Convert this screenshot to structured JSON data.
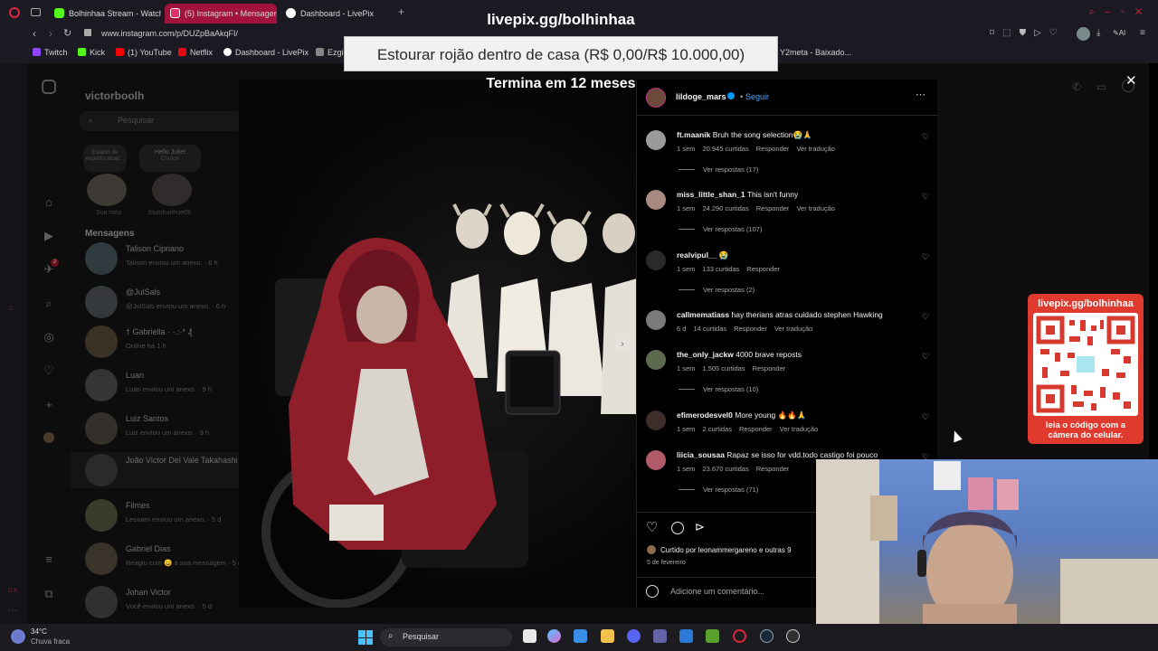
{
  "browser": {
    "tabs": [
      {
        "label": "Bolhinhaa Stream - Watch",
        "color": "#53fc18"
      },
      {
        "label": "(5) Instagram • Mensagen",
        "color": "#e1306c"
      },
      {
        "label": "Dashboard - LivePix",
        "color": "#ffffff"
      }
    ],
    "new_tab": "+",
    "url": "www.instagram.com/p/DUZpBaAkqFI/",
    "bookmarks": [
      {
        "label": "Twitch",
        "color": "#9146ff"
      },
      {
        "label": "Kick",
        "color": "#53fc18"
      },
      {
        "label": "(1) YouTube",
        "color": "#ff0000"
      },
      {
        "label": "Netflix",
        "color": "#e50914"
      },
      {
        "label": "Dashboard - LivePix",
        "color": "#ffffff"
      },
      {
        "label": "Ezgi",
        "color": "#888888"
      },
      {
        "label": "Y2meta - Baixado...",
        "color": "#888888"
      }
    ]
  },
  "overlay": {
    "top_url": "livepix.gg/bolhinhaa",
    "donation_goal": "Estourar rojão dentro de casa (R$ 0,00/R$ 10.000,00)",
    "ends_in": "Termina em 12 meses",
    "qr_title": "livepix.gg/bolhinhaa",
    "qr_caption": "leia o código com a câmera do celular."
  },
  "instagram": {
    "account": "victorboolh",
    "search_placeholder": "Pesquisar",
    "notes": [
      {
        "label": "Estado de espírito atual...",
        "sub": "Sua nota"
      },
      {
        "label": "Hello Juliet",
        "sub": "Clarion",
        "sub2": "thurshuehue69"
      }
    ],
    "messages_header": "Mensagens",
    "dms": [
      {
        "name": "Talison Cipriano",
        "sub": "Talison enviou um anexo. · 6 h"
      },
      {
        "name": "@JulSals",
        "sub": "@JulSals enviou um anexo. · 6 h"
      },
      {
        "name": "† Gabriella · ·.:·* ₰",
        "sub": "Online há 1 h"
      },
      {
        "name": "Luan",
        "sub": "Luan enviou um anexo. · 9 h"
      },
      {
        "name": "Luiz Santos",
        "sub": "Luiz enviou um anexo. · 9 h"
      },
      {
        "name": "João Victor Del Vale Takahashi",
        "sub": ""
      },
      {
        "name": "Filmes",
        "sub": "Leonam enviou um anexo. · 5 d"
      },
      {
        "name": "Gabriel Dias",
        "sub": "Reagiu com 😄 à sua mensagem · 5 d"
      },
      {
        "name": "Johan Victor",
        "sub": "Você enviou um anexo. · 5 d"
      }
    ],
    "notification_badge": "2",
    "post": {
      "author": "lildoge_mars",
      "follow": "Seguir",
      "comments": [
        {
          "user": "ft.maanik",
          "text": "Bruh the song selection😭🙏",
          "time": "1 sem",
          "likes": "20.945 curtidas",
          "reply": "Responder",
          "translate": "Ver tradução",
          "replies": "Ver respostas (17)"
        },
        {
          "user": "miss_little_shan_1",
          "text": "This isn't funny",
          "time": "1 sem",
          "likes": "24.290 curtidas",
          "reply": "Responder",
          "translate": "Ver tradução",
          "replies": "Ver respostas (107)"
        },
        {
          "user": "realvipul__",
          "text": "😭",
          "time": "1 sem",
          "likes": "133 curtidas",
          "reply": "Responder",
          "translate": "",
          "replies": "Ver respostas (2)"
        },
        {
          "user": "callmematiass",
          "text": "hay therians atras cuidado stephen Hawking",
          "time": "6 d",
          "likes": "14 curtidas",
          "reply": "Responder",
          "translate": "Ver tradução",
          "replies": ""
        },
        {
          "user": "the_only_jackw",
          "text": "4000 brave reposts",
          "time": "1 sem",
          "likes": "1.505 curtidas",
          "reply": "Responder",
          "translate": "",
          "replies": "Ver respostas (10)"
        },
        {
          "user": "efimerodesvel0",
          "text": "More young 🔥🔥🙏",
          "time": "1 sem",
          "likes": "2 curtidas",
          "reply": "Responder",
          "translate": "Ver tradução",
          "replies": ""
        },
        {
          "user": "liicia_sousaa",
          "text": "Rapaz se isso for vdd.todo castigo foi pouco",
          "time": "1 sem",
          "likes": "23.670 curtidas",
          "reply": "Responder",
          "translate": "",
          "replies": "Ver respostas (71)"
        }
      ],
      "liked_by": "Curtido por leonammergareno e outras 9",
      "date": "5 de fevereiro",
      "comment_placeholder": "Adicione um comentário..."
    }
  },
  "taskbar": {
    "temp": "34°C",
    "weather": "Chuva fraca",
    "search": "Pesquisar"
  }
}
